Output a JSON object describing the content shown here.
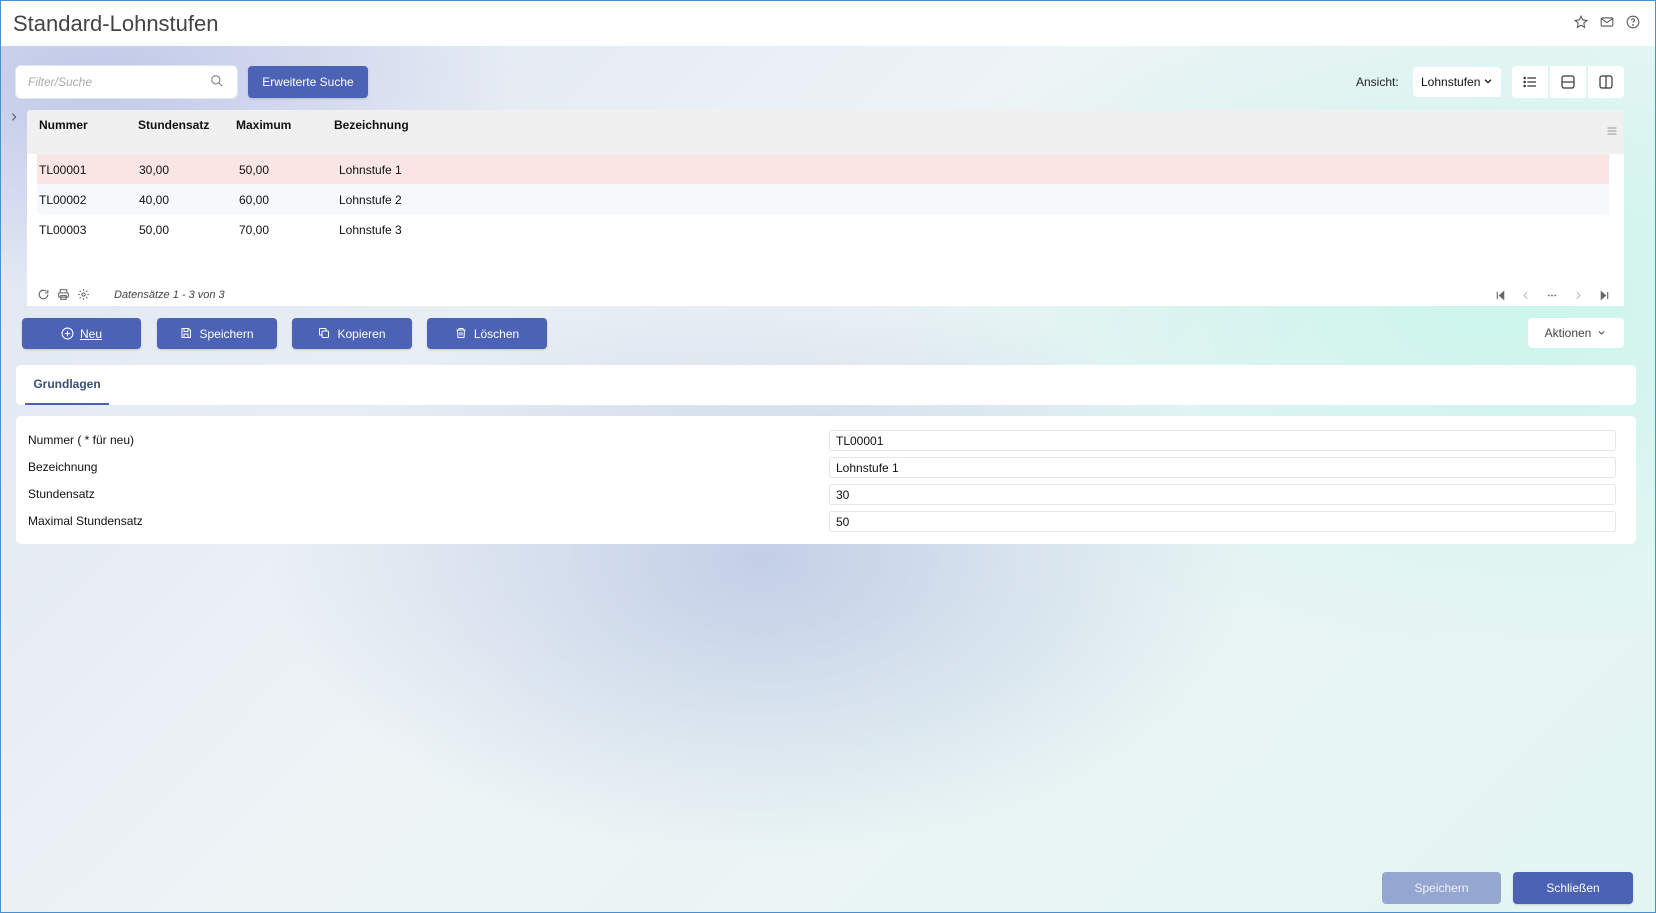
{
  "window": {
    "title": "Standard-Lohnstufen"
  },
  "title_icons": [
    "star-icon",
    "mail-icon",
    "help-icon"
  ],
  "search": {
    "placeholder": "Filter/Suche",
    "value": ""
  },
  "toolbar": {
    "extended_search_label": "Erweiterte Suche",
    "view_label": "Ansicht:",
    "view_selected": "Lohnstufen"
  },
  "grid": {
    "columns": [
      "Nummer",
      "Stundensatz",
      "Maximum",
      "Bezeichnung"
    ],
    "rows": [
      {
        "nummer": "TL00001",
        "stundensatz": "30,00",
        "maximum": "50,00",
        "bezeichnung": "Lohnstufe 1",
        "selected": true
      },
      {
        "nummer": "TL00002",
        "stundensatz": "40,00",
        "maximum": "60,00",
        "bezeichnung": "Lohnstufe 2",
        "selected": false
      },
      {
        "nummer": "TL00003",
        "stundensatz": "50,00",
        "maximum": "70,00",
        "bezeichnung": "Lohnstufe 3",
        "selected": false
      }
    ],
    "records_text": "Datensätze 1 - 3 von 3"
  },
  "actions": {
    "new_label": "Neu",
    "save_label": "Speichern",
    "copy_label": "Kopieren",
    "delete_label": "Löschen",
    "more_label": "Aktionen"
  },
  "tabs": [
    {
      "label": "Grundlagen",
      "active": true
    }
  ],
  "form": {
    "fields": [
      {
        "label": "Nummer ( * für neu)",
        "value": "TL00001"
      },
      {
        "label": "Bezeichnung",
        "value": "Lohnstufe 1"
      },
      {
        "label": "Stundensatz",
        "value": "30"
      },
      {
        "label": "Maximal Stundensatz",
        "value": "50"
      }
    ]
  },
  "footer": {
    "save_label": "Speichern",
    "close_label": "Schließen"
  },
  "colors": {
    "accent": "#4b62b5",
    "accent_disabled": "#95a6d1",
    "selected_row": "#f9e6e4",
    "alt_row": "#f6f8fc",
    "header_bg": "#f0f0f0"
  }
}
